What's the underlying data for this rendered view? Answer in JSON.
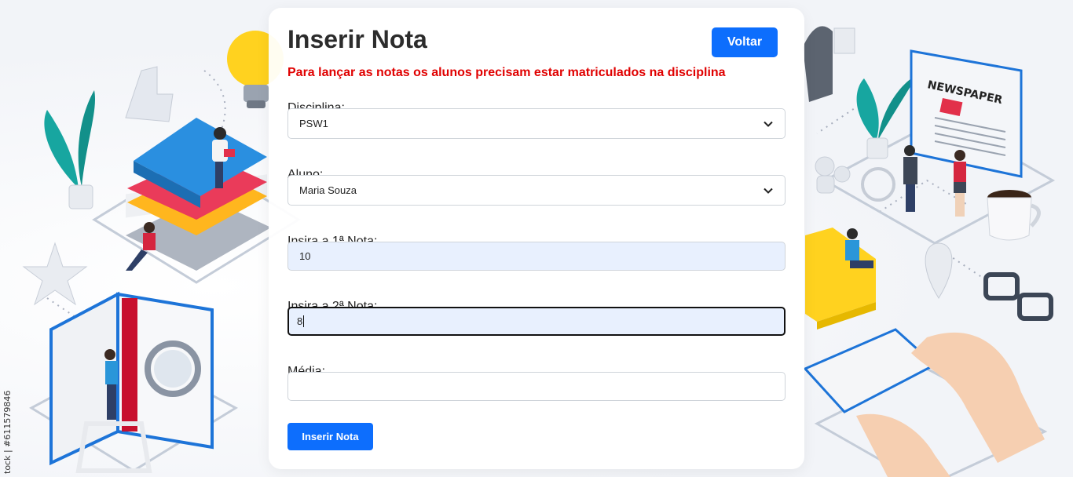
{
  "header": {
    "title": "Inserir Nota",
    "back_label": "Voltar"
  },
  "warning": "Para lançar as notas os alunos precisam estar matriculados na disciplina",
  "form": {
    "disciplina": {
      "label": "Disciplina:",
      "value": "PSW1"
    },
    "aluno": {
      "label": "Aluno:",
      "value": "Maria Souza"
    },
    "nota1": {
      "label": "Insira a 1ª Nota:",
      "value": "10"
    },
    "nota2": {
      "label": "Insira a 2ª Nota:",
      "value": "8"
    },
    "media": {
      "label": "Média:",
      "value": ""
    },
    "submit_label": "Inserir Nota"
  },
  "background": {
    "watermark": "tock | #611579846",
    "newspaper_text": "NEWSPAPER"
  },
  "colors": {
    "primary": "#0d6efd",
    "warning": "#e00000",
    "autofill": "#e8f0fe"
  }
}
